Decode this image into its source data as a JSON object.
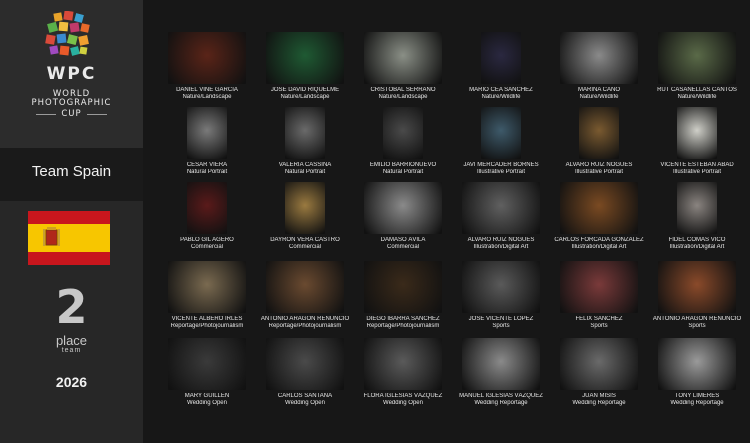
{
  "logo": {
    "acronym": "WPC",
    "line1": "WORLD",
    "line2": "PHOTOGRAPHIC",
    "line3": "CUP",
    "icon": "wpc-logo-icon"
  },
  "team": {
    "name": "Team Spain",
    "flag": "spain-flag"
  },
  "placement": {
    "number": "2",
    "word": "place",
    "subtitle": "team"
  },
  "year": "2026",
  "rows": [
    [
      {
        "name": "DANIEL VIÑÉ GARCÍA",
        "category": "Nature/Landscape",
        "color": "#5a2418",
        "portrait": false
      },
      {
        "name": "JOSÉ DAVID RIQUELME",
        "category": "Nature/Landscape",
        "color": "#1f5a33",
        "portrait": false
      },
      {
        "name": "CRISTÓBAL SERRANO",
        "category": "Nature/Landscape",
        "color": "#8a8f86",
        "portrait": false
      },
      {
        "name": "MARIO CEA SÁNCHEZ",
        "category": "Nature/Wildlife",
        "color": "#2a2840",
        "portrait": true
      },
      {
        "name": "MARINA CANO",
        "category": "Nature/Wildlife",
        "color": "#8a8a8a",
        "portrait": false
      },
      {
        "name": "RUT CASANELLAS CANTOS",
        "category": "Nature/Wildlife",
        "color": "#5a6a48",
        "portrait": false
      }
    ],
    [
      {
        "name": "CÉSAR VIERA",
        "category": "Natural Portrait",
        "color": "#7a7a7a",
        "portrait": true
      },
      {
        "name": "VALERIA CASSINA",
        "category": "Natural Portrait",
        "color": "#6a6a6a",
        "portrait": true
      },
      {
        "name": "EMILIO BARRIONUEVO",
        "category": "Natural Portrait",
        "color": "#4a4a4a",
        "portrait": true
      },
      {
        "name": "JAVI MERCADER BORNES",
        "category": "Illustrative Portrait",
        "color": "#3e5a6a",
        "portrait": true
      },
      {
        "name": "ÁLVARO RUIZ NOGUES",
        "category": "Illustrative Portrait",
        "color": "#7a5a30",
        "portrait": true
      },
      {
        "name": "VICENTE ESTEBAN ABAD",
        "category": "Illustrative Portrait",
        "color": "#cfcfc8",
        "portrait": true
      }
    ],
    [
      {
        "name": "PABLO GIL AGERO",
        "category": "Commercial",
        "color": "#5a1a1a",
        "portrait": true
      },
      {
        "name": "DAYRON VERA CASTRO",
        "category": "Commercial",
        "color": "#9a7a40",
        "portrait": true
      },
      {
        "name": "DÁMASO ÁVILA",
        "category": "Commercial",
        "color": "#8a8a8a",
        "portrait": false
      },
      {
        "name": "ÁLVARO RUIZ NOGUES",
        "category": "Illustration/Digital Art",
        "color": "#606060",
        "portrait": false
      },
      {
        "name": "CARLOS FORCADA GONZÁLEZ",
        "category": "Illustration/Digital Art",
        "color": "#7a4a22",
        "portrait": false
      },
      {
        "name": "FIDEL COMAS VICO",
        "category": "Illustration/Digital Art",
        "color": "#8a8480",
        "portrait": true
      }
    ],
    [
      {
        "name": "VICENTE ALBERO IRLES",
        "category": "Reportage/Photojournalism",
        "color": "#7a6a50",
        "portrait": false
      },
      {
        "name": "ANTONIO ARAGÓN RENUNCIO",
        "category": "Reportage/Photojournalism",
        "color": "#6a4a30",
        "portrait": false
      },
      {
        "name": "DIEGO IBARRA SÁNCHEZ",
        "category": "Reportage/Photojournalism",
        "color": "#3a2a1a",
        "portrait": false
      },
      {
        "name": "JOSÉ VICENTE LÓPEZ",
        "category": "Sports",
        "color": "#5a5a5a",
        "portrait": false
      },
      {
        "name": "FÉLIX SÁNCHEZ",
        "category": "Sports",
        "color": "#7a3a3a",
        "portrait": false
      },
      {
        "name": "ANTONIO ARAGÓN RENUNCIO",
        "category": "Sports",
        "color": "#8a4a2a",
        "portrait": false
      }
    ],
    [
      {
        "name": "MARY GUILLÉN",
        "category": "Wedding Open",
        "color": "#3a3a3a",
        "portrait": false
      },
      {
        "name": "CARLOS SANTANA",
        "category": "Wedding Open",
        "color": "#4a4a4a",
        "portrait": false
      },
      {
        "name": "FLORA IGLESIAS VÁZQUEZ",
        "category": "Wedding Open",
        "color": "#5a5a5a",
        "portrait": false
      },
      {
        "name": "MANUEL IGLESIAS VÁZQUEZ",
        "category": "Wedding Reportage",
        "color": "#8a8a8a",
        "portrait": false
      },
      {
        "name": "JUAN MISIS",
        "category": "Wedding Reportage",
        "color": "#6a6a6a",
        "portrait": false
      },
      {
        "name": "TONY LIMERES",
        "category": "Wedding Reportage",
        "color": "#9a9a9a",
        "portrait": false
      }
    ]
  ]
}
